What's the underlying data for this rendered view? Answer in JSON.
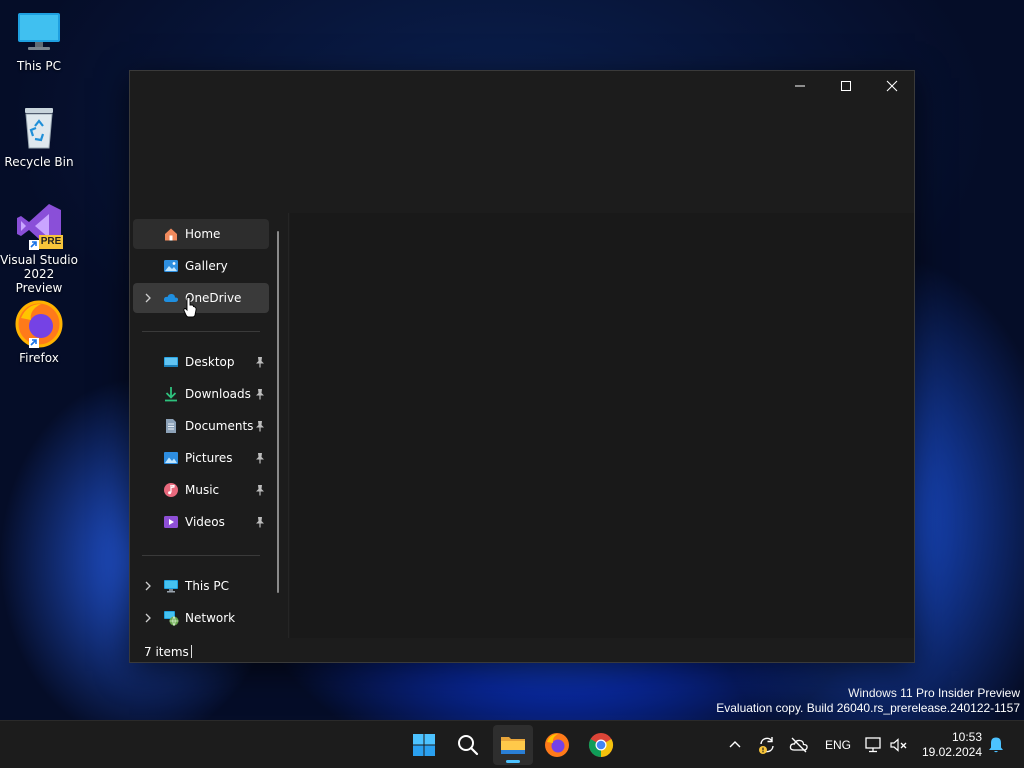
{
  "desktop": {
    "icons": [
      {
        "label_line1": "This PC",
        "label_line2": ""
      },
      {
        "label_line1": "Recycle Bin",
        "label_line2": ""
      },
      {
        "label_line1": "Visual Studio",
        "label_line2": "2022 Preview",
        "badge": "PRE"
      },
      {
        "label_line1": "Firefox",
        "label_line2": ""
      }
    ],
    "watermark": {
      "line1": "Windows 11 Pro Insider Preview",
      "line2": "Evaluation copy. Build 26040.rs_prerelease.240122-1157"
    }
  },
  "explorer": {
    "window_controls": {
      "minimize": "minimize-icon",
      "maximize": "maximize-icon",
      "close": "close-icon"
    },
    "nav": {
      "home": {
        "label": "Home",
        "icon": "home-icon"
      },
      "gallery": {
        "label": "Gallery",
        "icon": "gallery-icon"
      },
      "onedrive": {
        "label": "OneDrive",
        "icon": "cloud-icon"
      },
      "quick_access": [
        {
          "label": "Desktop",
          "icon": "desktop-folder-icon",
          "pinned": true
        },
        {
          "label": "Downloads",
          "icon": "download-icon",
          "pinned": true
        },
        {
          "label": "Documents",
          "icon": "document-icon",
          "pinned": true
        },
        {
          "label": "Pictures",
          "icon": "picture-icon",
          "pinned": true
        },
        {
          "label": "Music",
          "icon": "music-icon",
          "pinned": true
        },
        {
          "label": "Videos",
          "icon": "video-icon",
          "pinned": true
        }
      ],
      "this_pc": {
        "label": "This PC",
        "icon": "computer-icon"
      },
      "network": {
        "label": "Network",
        "icon": "network-icon"
      }
    },
    "status": {
      "items": "7 items"
    }
  },
  "taskbar": {
    "apps": [
      "start-icon",
      "search-icon",
      "file-explorer-icon",
      "firefox-icon",
      "chrome-icon"
    ],
    "tray": {
      "language": "ENG",
      "time": "10:53",
      "date": "19.02.2024"
    }
  },
  "colors": {
    "accent": "#4cc2ff",
    "window_bg": "#1c1c1c",
    "taskbar_bg": "#1c1c1c"
  }
}
